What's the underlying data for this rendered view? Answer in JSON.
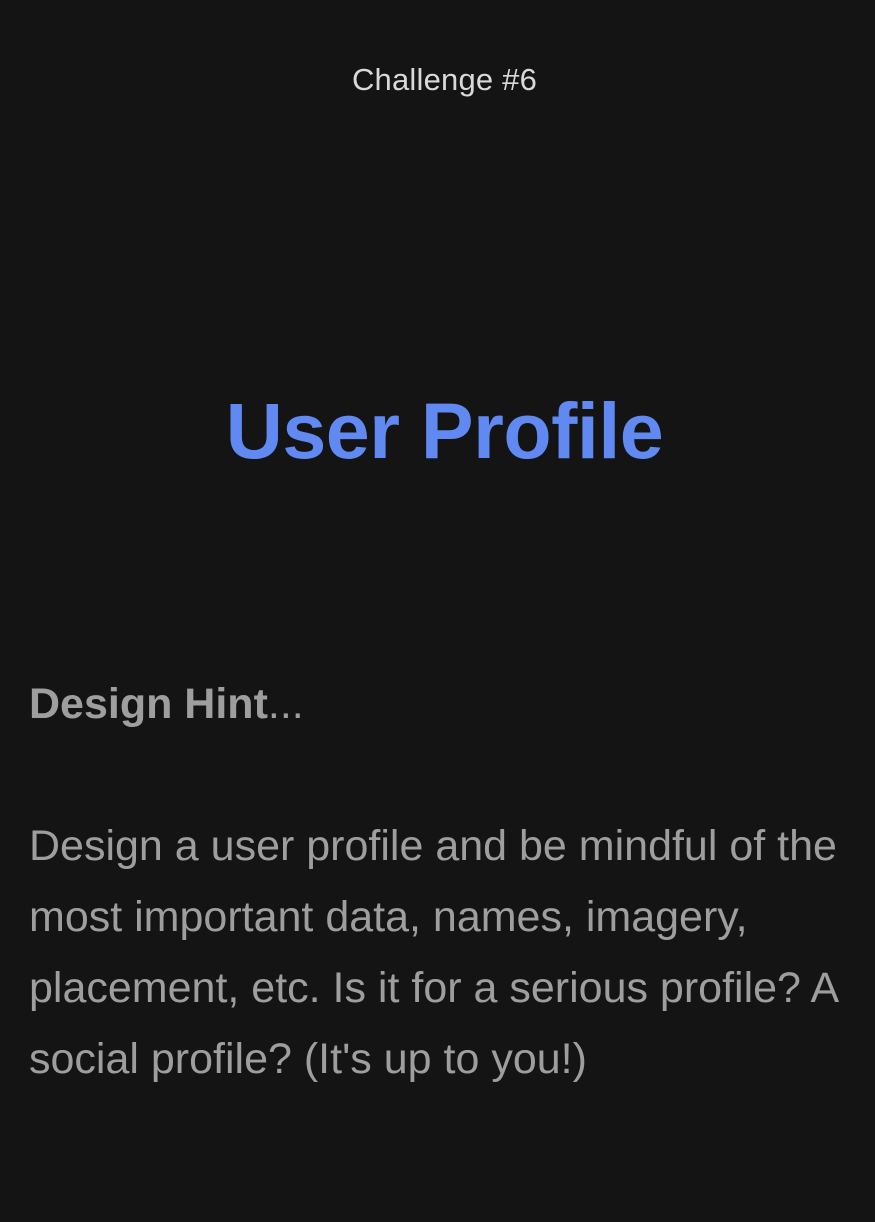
{
  "header": {
    "challenge_label": "Challenge #6"
  },
  "main": {
    "title": "User Profile",
    "hint": {
      "heading_bold": "Design Hint",
      "heading_suffix": "...",
      "body": "Design a user profile and be mindful of the most important data, names, imagery, placement, etc. Is it for a serious profile? A social profile? (It's up to you!)"
    }
  },
  "colors": {
    "background": "#141414",
    "accent": "#6189f2",
    "muted_text": "#9e9e9e",
    "label_text": "#d9d9d9"
  }
}
